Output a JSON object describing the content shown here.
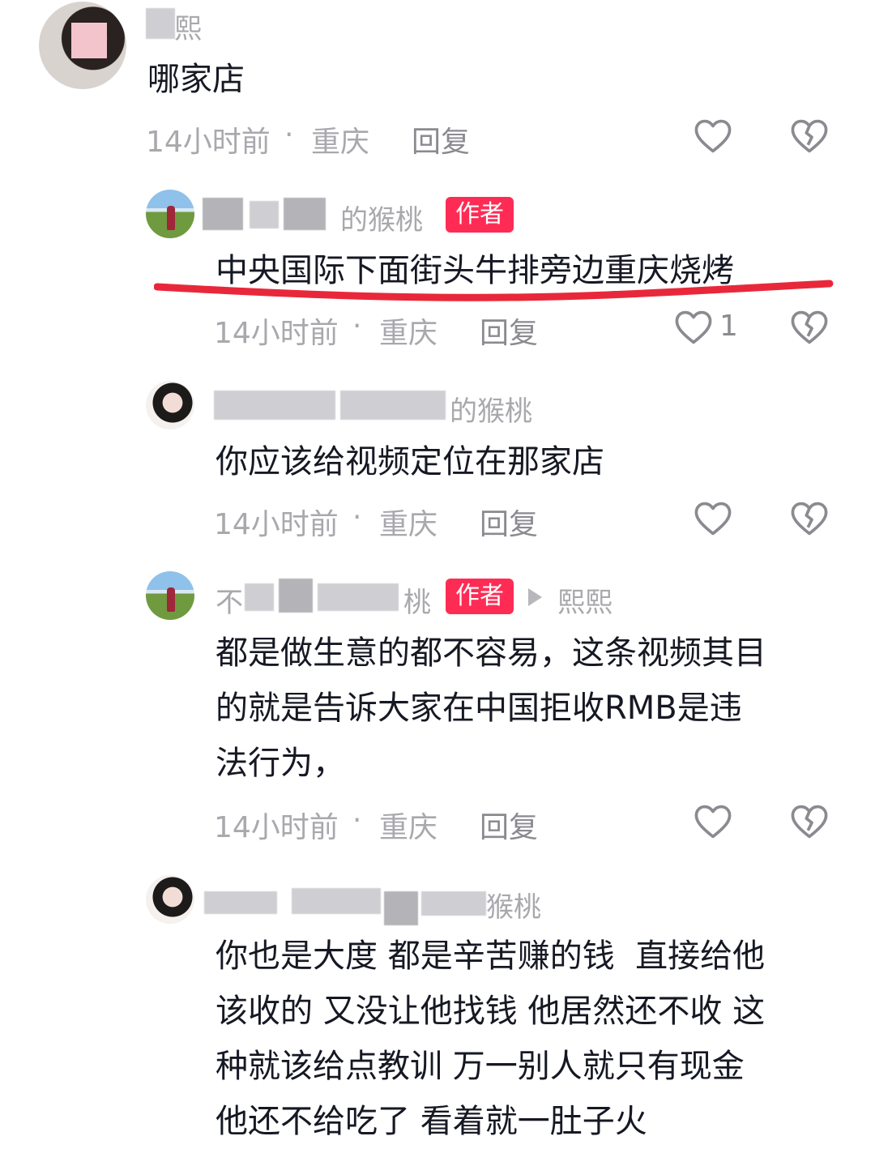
{
  "comments": [
    {
      "username_visible": "熙",
      "content": "哪家店",
      "time": "14小时前",
      "location": "重庆",
      "reply_label": "回复"
    },
    {
      "username_visible": "的猴桃",
      "badge": "作者",
      "content": "中央国际下面街头牛排旁边重庆烧烤",
      "time": "14小时前",
      "location": "重庆",
      "reply_label": "回复",
      "like_count": "1"
    },
    {
      "username_visible": "的猴桃",
      "content": "你应该给视频定位在那家店",
      "time": "14小时前",
      "location": "重庆",
      "reply_label": "回复"
    },
    {
      "username_visible_prefix": "不",
      "username_visible": "桃",
      "badge": "作者",
      "reply_to": "熙熙",
      "content": "都是做生意的都不容易，这条视频其目\n的就是告诉大家在中国拒收RMB是违\n法行为，",
      "time": "14小时前",
      "location": "重庆",
      "reply_label": "回复"
    },
    {
      "username_visible": "猴桃",
      "content": "你也是大度 都是辛苦赚的钱  直接给他\n该收的 又没让他找钱 他居然还不收 这\n种就该给点教训 万一别人就只有现金\n他还不给吃了 看着就一肚子火"
    }
  ],
  "meta_separator": "·",
  "colors": {
    "badge": "#fe2c55",
    "annotation_underline": "#e8283a",
    "secondary_text": "#a8a8ad"
  },
  "icons": {
    "like": "heart-outline-icon",
    "dislike": "broken-heart-icon",
    "reply_arrow": "triangle-right-icon"
  }
}
